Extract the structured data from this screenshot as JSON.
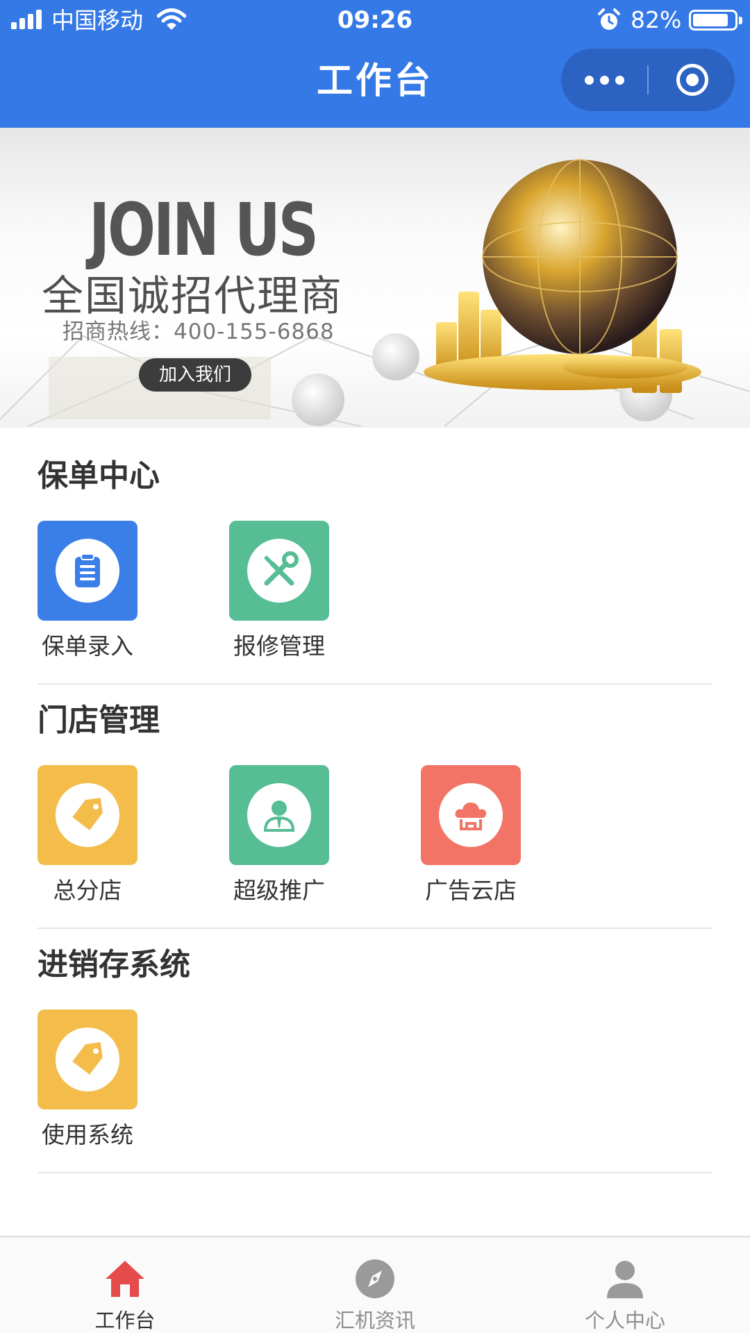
{
  "status_bar": {
    "carrier": "中国移动",
    "time": "09:26",
    "battery": "82%"
  },
  "nav": {
    "title": "工作台"
  },
  "banner": {
    "heading": "JOIN US",
    "slogan": "全国诚招代理商",
    "hotline": "招商热线：400-155-6868",
    "button": "加入我们"
  },
  "sections": [
    {
      "title": "保单中心",
      "items": [
        {
          "label": "保单录入",
          "icon": "clipboard-icon",
          "color": "#3a7fe8"
        },
        {
          "label": "报修管理",
          "icon": "repair-tools-icon",
          "color": "#57bd95"
        }
      ]
    },
    {
      "title": "门店管理",
      "items": [
        {
          "label": "总分店",
          "icon": "tag-icon",
          "color": "#f4bd4b"
        },
        {
          "label": "超级推广",
          "icon": "person-icon",
          "color": "#57bd95"
        },
        {
          "label": "广告云店",
          "icon": "cloud-store-icon",
          "color": "#f27467"
        }
      ]
    },
    {
      "title": "进销存系统",
      "items": [
        {
          "label": "使用系统",
          "icon": "tag-icon",
          "color": "#f4bd4b"
        }
      ]
    }
  ],
  "tabbar": {
    "items": [
      {
        "label": "工作台",
        "icon": "home-icon",
        "active": true,
        "color": "#e54b4b"
      },
      {
        "label": "汇机资讯",
        "icon": "compass-icon",
        "active": false,
        "color": "#9a9a9a"
      },
      {
        "label": "个人中心",
        "icon": "user-icon",
        "active": false,
        "color": "#9a9a9a"
      }
    ]
  },
  "colors": {
    "header": "#3479e6",
    "capsule": "#2c63c2"
  }
}
